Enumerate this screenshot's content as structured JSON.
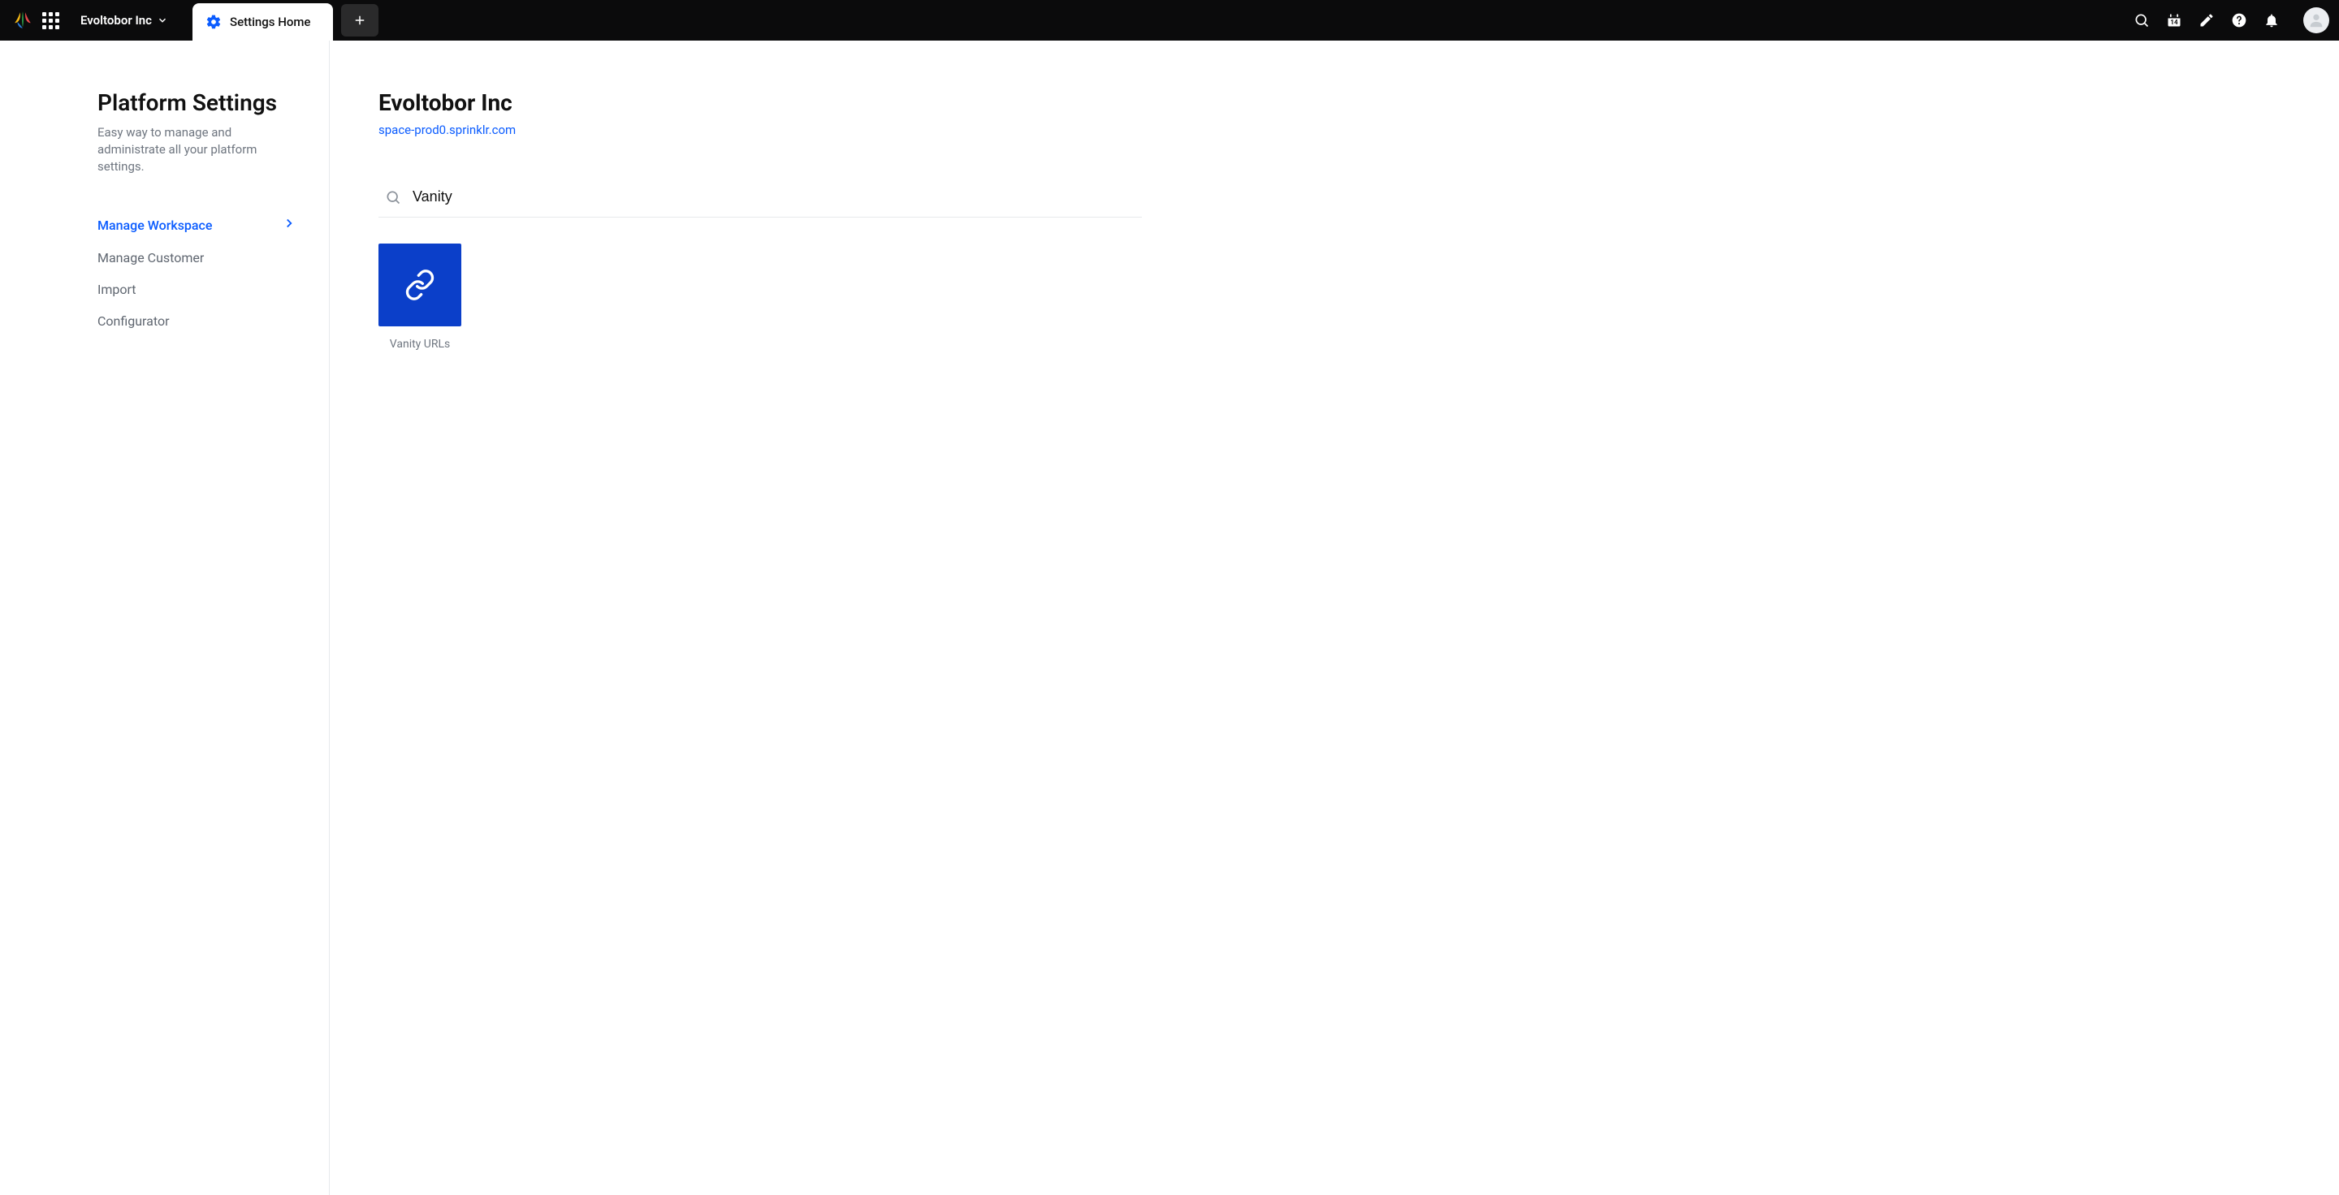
{
  "topnav": {
    "org_name": "Evoltobor Inc",
    "tab_label": "Settings Home",
    "calendar_badge": "14"
  },
  "sidebar": {
    "title": "Platform Settings",
    "description": "Easy way to manage and administrate all your platform settings.",
    "items": [
      {
        "label": "Manage Workspace",
        "active": true
      },
      {
        "label": "Manage Customer",
        "active": false
      },
      {
        "label": "Import",
        "active": false
      },
      {
        "label": "Configurator",
        "active": false
      }
    ]
  },
  "main": {
    "title": "Evoltobor Inc",
    "domain_link": "space-prod0.sprinklr.com",
    "search_value": "Vanity",
    "tiles": [
      {
        "label": "Vanity URLs",
        "icon": "link-icon",
        "color": "#0b3fc9"
      }
    ]
  }
}
